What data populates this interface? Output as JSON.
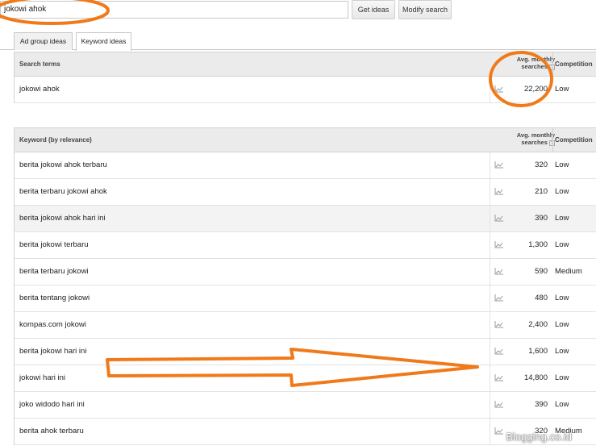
{
  "search": {
    "value": "jokowi ahok"
  },
  "buttons": {
    "get_ideas": "Get ideas",
    "modify_search": "Modify search"
  },
  "tabs": [
    {
      "label": "Ad group ideas",
      "active": false
    },
    {
      "label": "Keyword ideas",
      "active": true
    }
  ],
  "search_terms_table": {
    "col_term": "Search terms",
    "col_avg": "Avg. monthly searches",
    "col_comp": "Competition",
    "help": "?",
    "rows": [
      {
        "keyword": "jokowi ahok",
        "searches": "22,200",
        "competition": "Low"
      }
    ]
  },
  "keyword_table": {
    "col_term": "Keyword (by relevance)",
    "col_avg": "Avg. monthly searches",
    "col_comp": "Competition",
    "help": "?",
    "rows": [
      {
        "keyword": "berita jokowi ahok terbaru",
        "searches": "320",
        "competition": "Low"
      },
      {
        "keyword": "berita terbaru jokowi ahok",
        "searches": "210",
        "competition": "Low"
      },
      {
        "keyword": "berita jokowi ahok hari ini",
        "searches": "390",
        "competition": "Low"
      },
      {
        "keyword": "berita jokowi terbaru",
        "searches": "1,300",
        "competition": "Low"
      },
      {
        "keyword": "berita terbaru jokowi",
        "searches": "590",
        "competition": "Medium"
      },
      {
        "keyword": "berita tentang jokowi",
        "searches": "480",
        "competition": "Low"
      },
      {
        "keyword": "kompas.com jokowi",
        "searches": "2,400",
        "competition": "Low"
      },
      {
        "keyword": "berita jokowi hari ini",
        "searches": "1,600",
        "competition": "Low"
      },
      {
        "keyword": "jokowi hari ini",
        "searches": "14,800",
        "competition": "Low"
      },
      {
        "keyword": "joko widodo hari ini",
        "searches": "390",
        "competition": "Low"
      },
      {
        "keyword": "berita ahok terbaru",
        "searches": "320",
        "competition": "Medium"
      }
    ]
  },
  "watermark": "Blogging.co.id",
  "colors": {
    "annotation": "#f07a1a",
    "header_bg": "#ebebeb"
  },
  "icons": {
    "trend": "trend-chart-icon",
    "help": "help-icon"
  }
}
